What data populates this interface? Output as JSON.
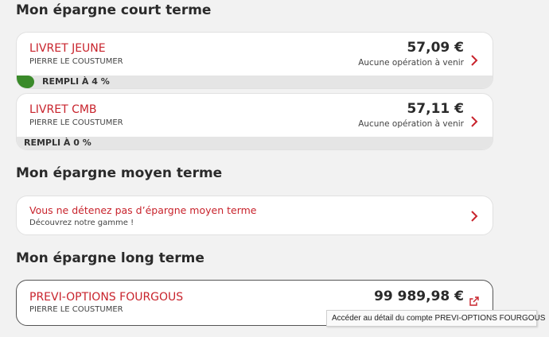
{
  "sections": {
    "short_term": {
      "title": "Mon épargne court terme",
      "accounts": [
        {
          "name": "LIVRET JEUNE",
          "holder": "PIERRE LE COUSTUMER",
          "amount": "57,09 €",
          "ops": "Aucune opération à venir",
          "fill_label": "REMPLI À 4 %",
          "fill_fraction": 0.04
        },
        {
          "name": "LIVRET CMB",
          "holder": "PIERRE LE COUSTUMER",
          "amount": "57,11 €",
          "ops": "Aucune opération à venir",
          "fill_label": "REMPLI À 0 %",
          "fill_fraction": 0
        }
      ]
    },
    "medium_term": {
      "title": "Mon épargne moyen terme",
      "message": "Vous ne détenez pas d’épargne moyen terme",
      "sub": "Découvrez notre gamme !"
    },
    "long_term": {
      "title": "Mon épargne long terme",
      "account": {
        "name": "PREVI-OPTIONS FOURGOUS",
        "holder": "PIERRE LE COUSTUMER",
        "amount": "99 989,98 €"
      }
    }
  },
  "tooltip": "Accéder au détail du compte PREVI-OPTIONS FOURGOUS",
  "colors": {
    "accent_red": "#c8232c",
    "fill_green": "#3a8a2a",
    "background": "#f2f2f2"
  },
  "icons": {
    "chevron": "chevron-right-icon",
    "external": "external-link-icon"
  }
}
